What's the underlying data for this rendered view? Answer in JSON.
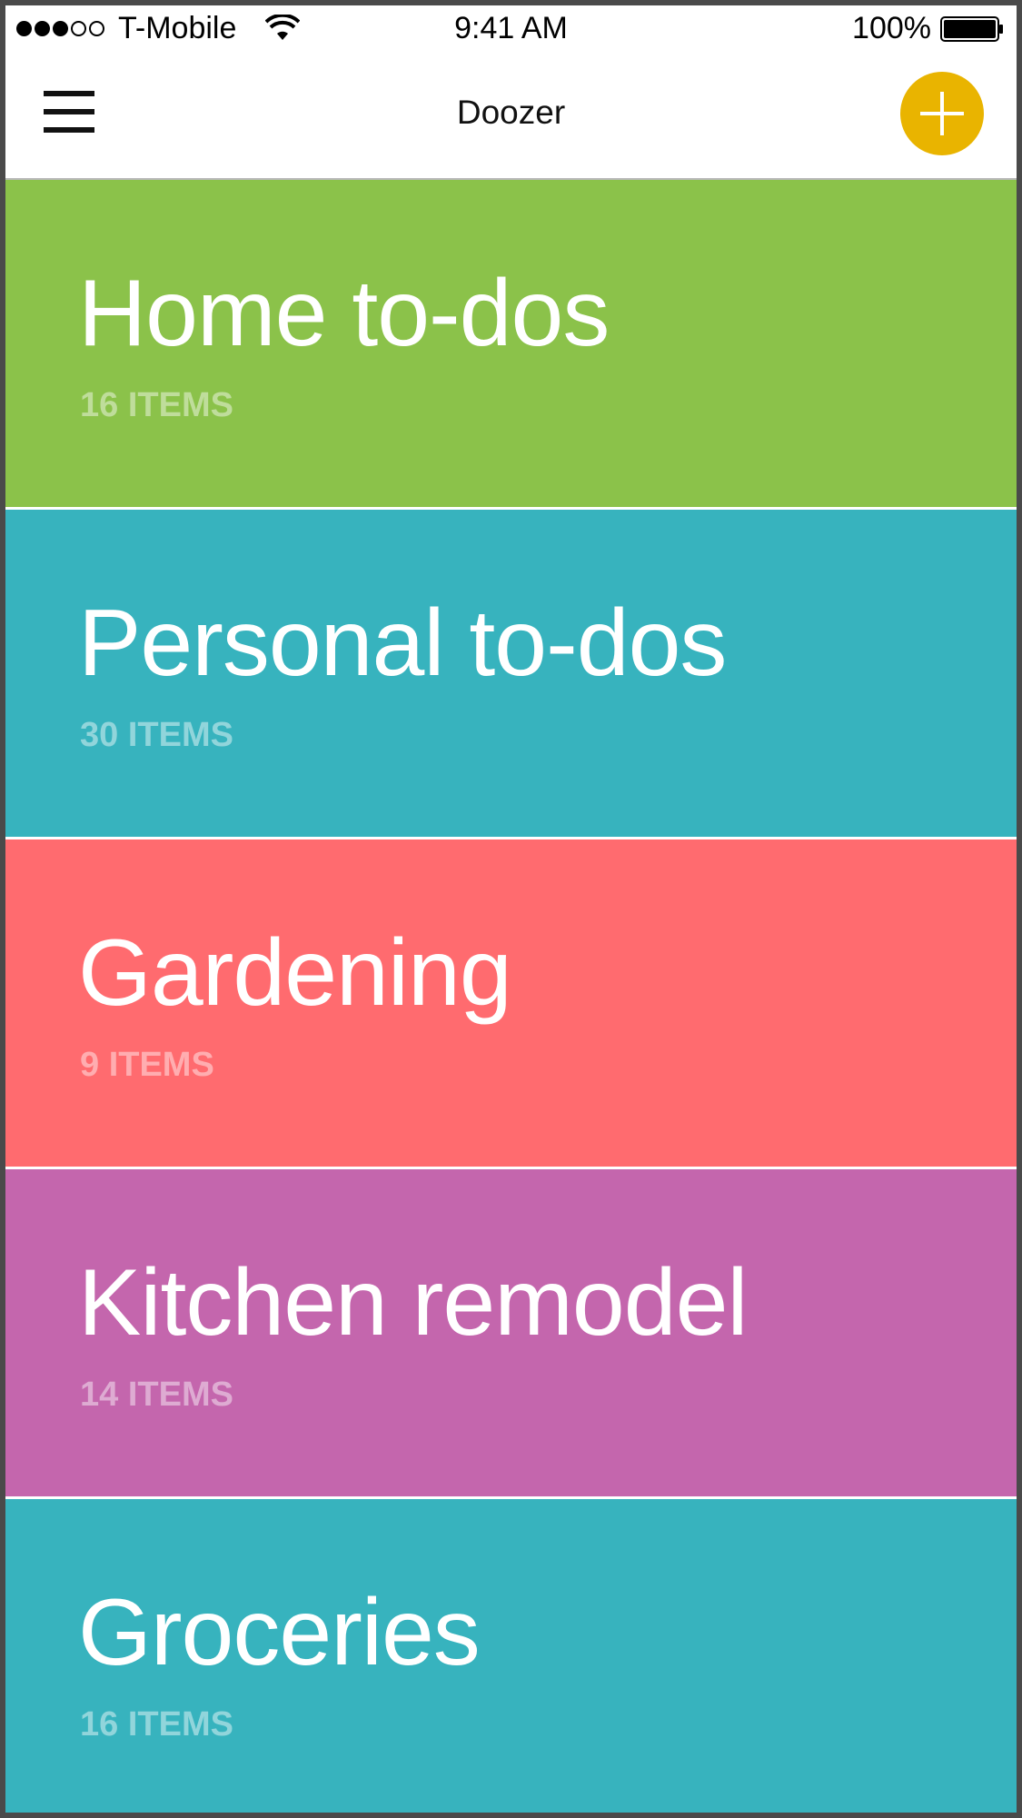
{
  "status_bar": {
    "carrier": "T-Mobile",
    "time": "9:41 AM",
    "battery_percent": "100%",
    "signal_bars_filled": 3,
    "signal_bars_total": 5
  },
  "nav": {
    "title": "Doozer",
    "menu_icon": "hamburger-menu-icon",
    "add_icon": "plus-icon",
    "add_color": "#e9b400"
  },
  "lists": [
    {
      "title": "Home to-dos",
      "count": "16 ITEMS",
      "color": "#8bc24a"
    },
    {
      "title": "Personal to-dos",
      "count": "30 ITEMS",
      "color": "#37b3be"
    },
    {
      "title": "Gardening",
      "count": "9 ITEMS",
      "color": "#ff6b6f"
    },
    {
      "title": "Kitchen remodel",
      "count": "14 ITEMS",
      "color": "#c466ad"
    },
    {
      "title": "Groceries",
      "count": "16 ITEMS",
      "color": "#37b3be"
    }
  ]
}
